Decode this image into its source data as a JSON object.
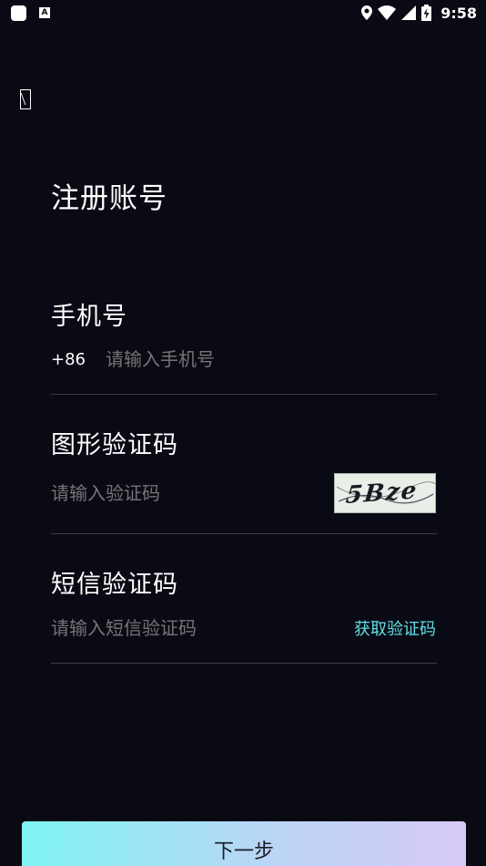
{
  "status_bar": {
    "time": "9:58",
    "a_icon_letter": "A"
  },
  "page": {
    "title": "注册账号"
  },
  "phone": {
    "label": "手机号",
    "country_code": "+86",
    "placeholder": "请输入手机号"
  },
  "captcha": {
    "label": "图形验证码",
    "placeholder": "请输入验证码",
    "image_text": "5Bze"
  },
  "sms": {
    "label": "短信验证码",
    "placeholder": "请输入短信验证码",
    "get_code_label": "获取验证码"
  },
  "next_button": {
    "label": "下一步"
  },
  "colors": {
    "background": "#0a0a14",
    "accent": "#5ee0e6",
    "button_gradient_start": "#7ef3f3",
    "button_gradient_end": "#d7c8f7"
  }
}
